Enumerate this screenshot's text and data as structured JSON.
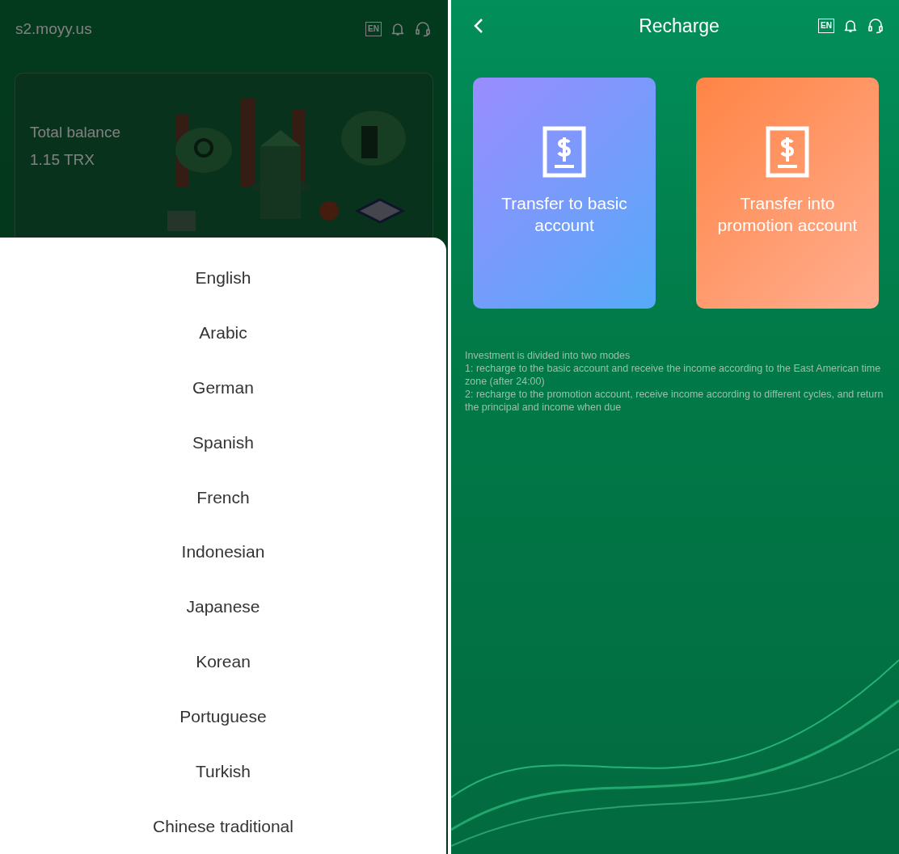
{
  "left_screen": {
    "header": {
      "site": "s2.moyy.us",
      "lang_badge": "EN"
    },
    "balance_card": {
      "label": "Total balance",
      "value": "1.15 TRX"
    },
    "language_sheet": {
      "items": [
        {
          "label": "English"
        },
        {
          "label": "Arabic"
        },
        {
          "label": "German"
        },
        {
          "label": "Spanish"
        },
        {
          "label": "French"
        },
        {
          "label": "Indonesian"
        },
        {
          "label": "Japanese"
        },
        {
          "label": "Korean"
        },
        {
          "label": "Portuguese"
        },
        {
          "label": "Turkish"
        },
        {
          "label": "Chinese traditional"
        }
      ]
    }
  },
  "right_screen": {
    "header": {
      "title": "Recharge",
      "lang_badge": "EN"
    },
    "options": [
      {
        "kind": "basic",
        "label": "Transfer to basic account"
      },
      {
        "kind": "promotion",
        "label": "Transfer into promotion account"
      }
    ],
    "notes": [
      "Investment is divided into two modes",
      "1: recharge to the basic account and receive the income according to the East American time zone (after 24:00)",
      "2: recharge to the promotion account, receive income according to different cycles, and return the principal and income when due"
    ]
  }
}
